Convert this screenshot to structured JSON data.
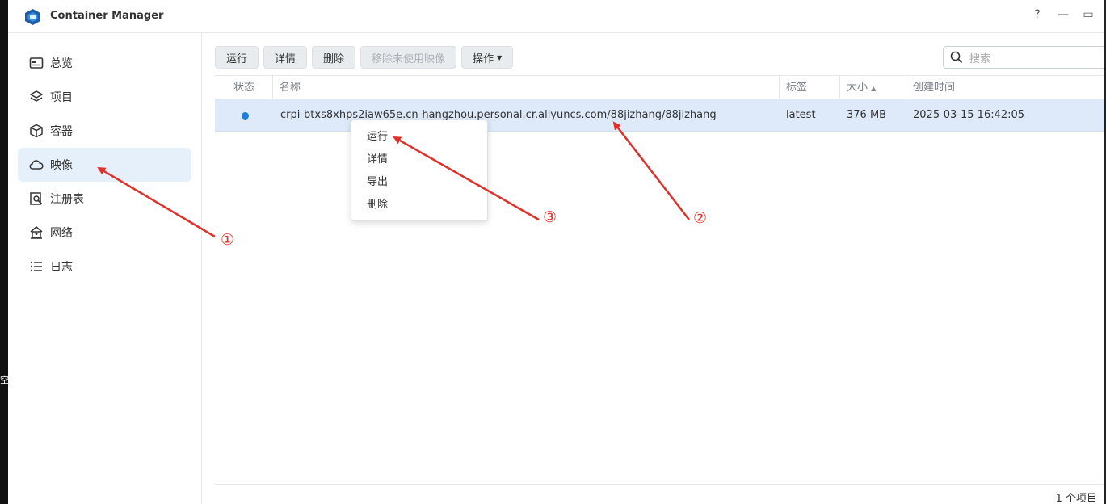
{
  "window": {
    "title": "Container Manager",
    "controls": [
      "?",
      "—",
      "▭"
    ]
  },
  "desktop": {
    "edge_text": "空"
  },
  "sidebar": {
    "items": [
      {
        "label": "总览",
        "icon": "overview-icon"
      },
      {
        "label": "项目",
        "icon": "layers-icon"
      },
      {
        "label": "容器",
        "icon": "box-icon"
      },
      {
        "label": "映像",
        "icon": "cloud-icon",
        "active": true
      },
      {
        "label": "注册表",
        "icon": "registry-icon"
      },
      {
        "label": "网络",
        "icon": "network-icon"
      },
      {
        "label": "日志",
        "icon": "list-icon"
      }
    ]
  },
  "toolbar": {
    "run": "运行",
    "details": "详情",
    "delete": "删除",
    "remove_unused": "移除未使用映像",
    "actions": "操作"
  },
  "search": {
    "placeholder": "搜索"
  },
  "table": {
    "headers": {
      "status": "状态",
      "name": "名称",
      "tag": "标签",
      "size": "大小",
      "created": "创建时间"
    },
    "rows": [
      {
        "name": "crpi-btxs8xhps2iaw65e.cn-hangzhou.personal.cr.aliyuncs.com/88jizhang/88jizhang",
        "tag": "latest",
        "size": "376 MB",
        "created": "2025-03-15 16:42:05",
        "status_color": "#1e7de0"
      }
    ]
  },
  "context_menu": {
    "items": [
      "运行",
      "详情",
      "导出",
      "删除"
    ]
  },
  "footer": {
    "count": "1 个项目"
  },
  "annotations": {
    "color": "#e0302a",
    "labels": [
      "①",
      "②",
      "③"
    ]
  }
}
